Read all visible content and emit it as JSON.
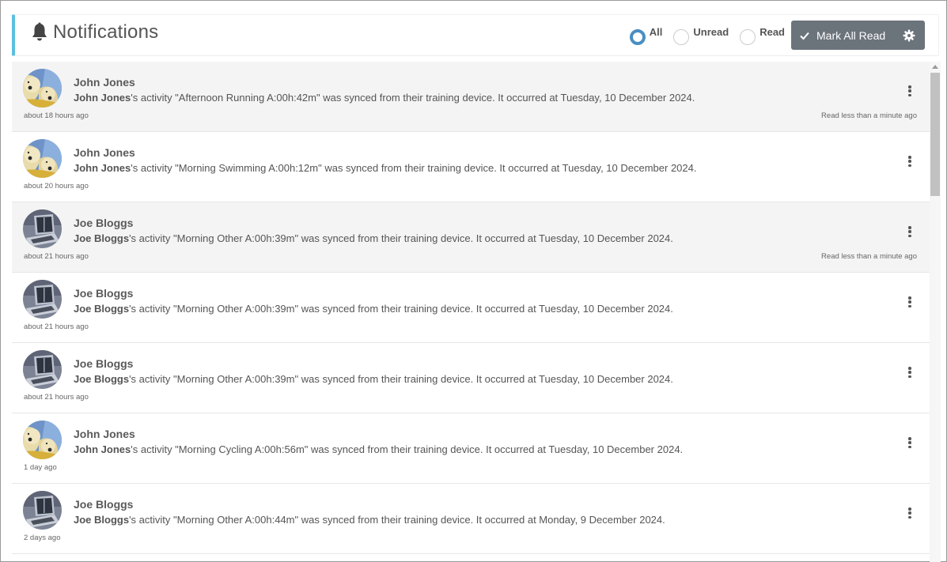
{
  "header": {
    "title": "Notifications",
    "icon": "bell-icon",
    "accent_color": "#5bc0de"
  },
  "filters": {
    "selected": "All",
    "options": [
      {
        "label": "All",
        "checked": true
      },
      {
        "label": "Unread",
        "checked": false
      },
      {
        "label": "Read",
        "checked": false
      }
    ]
  },
  "toolbar": {
    "mark_all_read_label": "Mark All Read",
    "mark_all_read_icon": "check-icon",
    "settings_icon": "gear-icon",
    "button_color": "#6b737b"
  },
  "notifications": [
    {
      "user": "John Jones",
      "avatar": "polar-bears",
      "suffix": "'s activity \"Afternoon Running A:00h:42m\" was synced from their training device. It occurred at Tuesday, 10 December 2024.",
      "time": "about 18 hours ago",
      "read_time": "Read less than a minute ago",
      "read": true
    },
    {
      "user": "John Jones",
      "avatar": "polar-bears",
      "suffix": "'s activity \"Morning Swimming A:00h:12m\" was synced from their training device. It occurred at Tuesday, 10 December 2024.",
      "time": "about 20 hours ago",
      "read_time": "",
      "read": false
    },
    {
      "user": "Joe Bloggs",
      "avatar": "laptop",
      "suffix": "'s activity \"Morning Other A:00h:39m\" was synced from their training device. It occurred at Tuesday, 10 December 2024.",
      "time": "about 21 hours ago",
      "read_time": "Read less than a minute ago",
      "read": true
    },
    {
      "user": "Joe Bloggs",
      "avatar": "laptop",
      "suffix": "'s activity \"Morning Other A:00h:39m\" was synced from their training device. It occurred at Tuesday, 10 December 2024.",
      "time": "about 21 hours ago",
      "read_time": "",
      "read": false
    },
    {
      "user": "Joe Bloggs",
      "avatar": "laptop",
      "suffix": "'s activity \"Morning Other A:00h:39m\" was synced from their training device. It occurred at Tuesday, 10 December 2024.",
      "time": "about 21 hours ago",
      "read_time": "",
      "read": false
    },
    {
      "user": "John Jones",
      "avatar": "polar-bears",
      "suffix": "'s activity \"Morning Cycling A:00h:56m\" was synced from their training device. It occurred at Tuesday, 10 December 2024.",
      "time": "1 day ago",
      "read_time": "",
      "read": false
    },
    {
      "user": "Joe Bloggs",
      "avatar": "laptop",
      "suffix": "'s activity \"Morning Other A:00h:44m\" was synced from their training device. It occurred at Monday, 9 December 2024.",
      "time": "2 days ago",
      "read_time": "",
      "read": false
    }
  ]
}
